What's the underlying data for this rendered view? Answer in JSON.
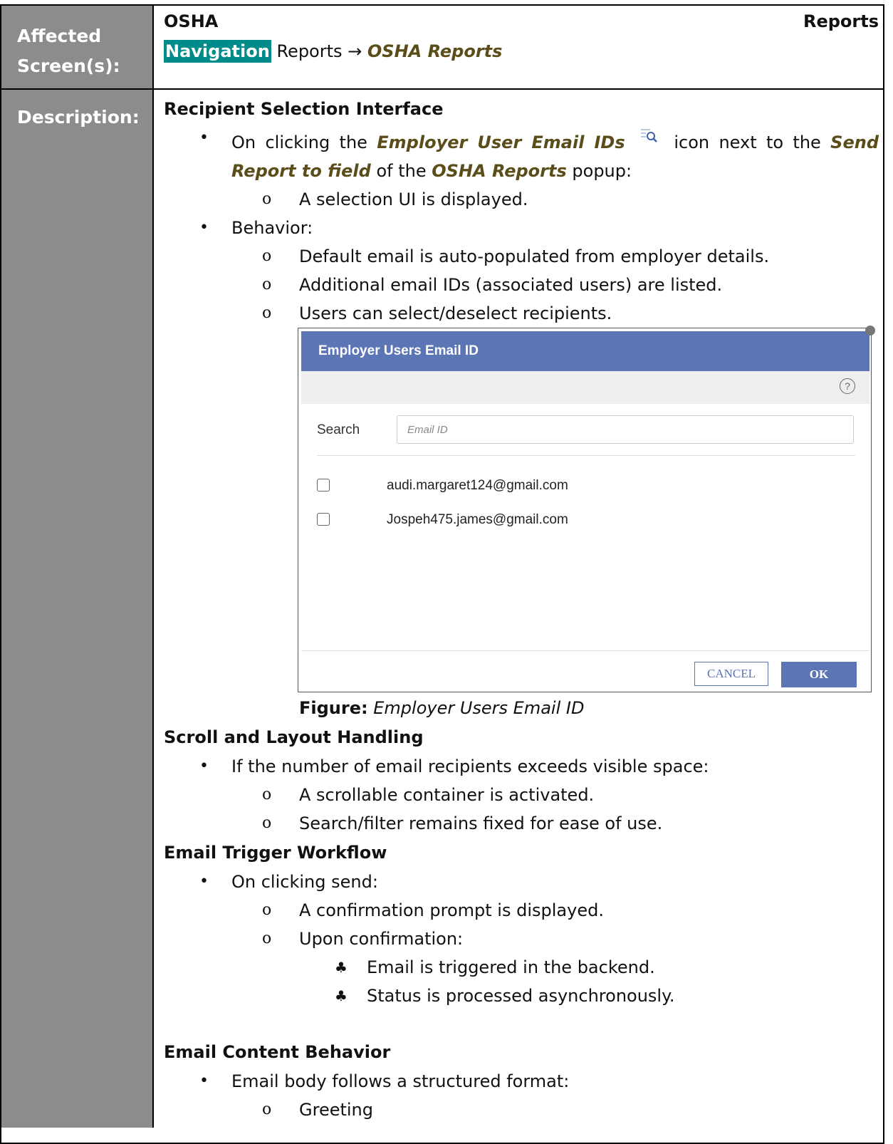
{
  "table": {
    "row1": {
      "label_line1": "Affected",
      "label_line2": "Screen(s):",
      "title_left": "OSHA",
      "title_right": "Reports",
      "nav_label": "Navigation",
      "nav_path_plain": "Reports →",
      "nav_path_emph": "OSHA Reports"
    },
    "row2": {
      "label": "Description:"
    }
  },
  "description": {
    "section1": {
      "heading": "Recipient Selection Interface",
      "bullet1": {
        "t1": "On clicking the",
        "e1": "Employer User Email IDs",
        "icon": "search-list-icon",
        "t2": "icon next to the",
        "e2": "Send Report to field",
        "t3": "of the",
        "e3": "OSHA Reports",
        "t4": "popup:",
        "sub1": "A selection UI is displayed."
      },
      "bullet2": {
        "text": "Behavior:",
        "sub1": "Default email is auto-populated from employer details.",
        "sub2": "Additional email IDs (associated users) are listed.",
        "sub3": "Users can select/deselect recipients."
      }
    },
    "dialog": {
      "title": "Employer Users Email ID",
      "help_glyph": "?",
      "search_label": "Search",
      "search_placeholder": "Email ID",
      "emails": [
        "audi.margaret124@gmail.com",
        "Jospeh475.james@gmail.com"
      ],
      "cancel_label": "CANCEL",
      "ok_label": "OK",
      "header_color": "#5b75b5"
    },
    "caption": {
      "prefix": "Figure:",
      "title": "Employer Users Email ID"
    },
    "section2": {
      "heading": "Scroll and Layout Handling",
      "bullet1": "If the number of email recipients exceeds visible space:",
      "sub1": "A scrollable container is activated.",
      "sub2": "Search/filter remains fixed for ease of use."
    },
    "section3": {
      "heading": "Email Trigger Workflow",
      "bullet1": "On clicking send:",
      "sub1": "A confirmation prompt is displayed.",
      "sub2": "Upon confirmation:",
      "subsub1": "Email is triggered in the backend.",
      "subsub2": "Status is processed asynchronously."
    },
    "section4": {
      "heading": "Email Content Behavior",
      "bullet1": "Email body follows a structured format:",
      "sub1": "Greeting"
    }
  },
  "glyphs": {
    "bullet": "•",
    "sub_bullet": "o",
    "club": "♣"
  },
  "colors": {
    "label_column": "#8c8c8c",
    "nav_highlight": "#008b8b",
    "emphasis_text": "#5a4d1a"
  }
}
